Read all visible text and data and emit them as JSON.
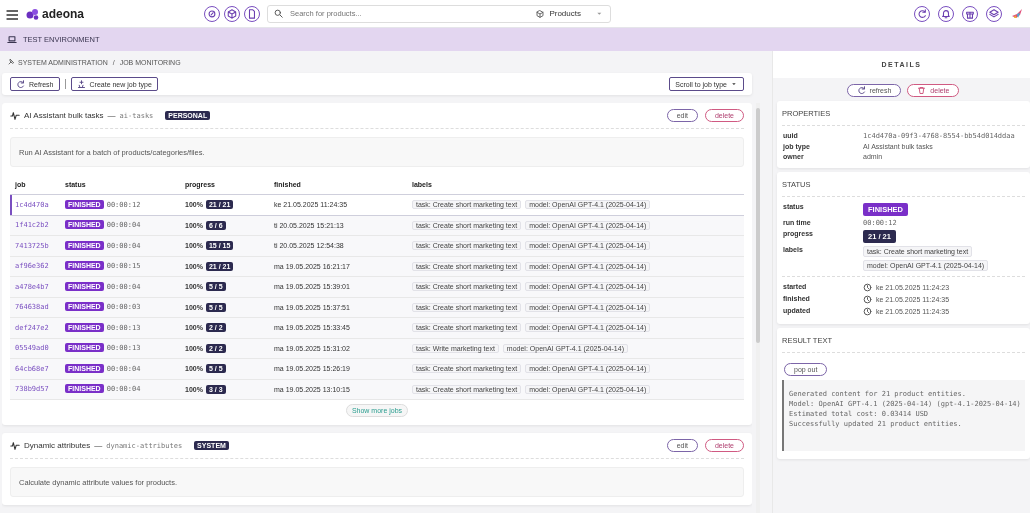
{
  "topbar": {
    "logo": "adeona",
    "search": {
      "placeholder": "Search for products..."
    },
    "scope": "Products"
  },
  "environment": "TEST ENVIRONMENT",
  "breadcrumb": {
    "items": [
      "SYSTEM ADMINISTRATION",
      "JOB MONITORING"
    ],
    "separator": "/"
  },
  "toolbar": {
    "refresh": "Refresh",
    "create": "Create new job type",
    "scroll": "Scroll to job type"
  },
  "job_types": [
    {
      "title": "AI Assistant bulk tasks",
      "dash": "—",
      "code": "ai-tasks",
      "badge": "PERSONAL",
      "edit": "edit",
      "delete": "delete",
      "description": "Run AI Assistant for a batch of products/categories/files.",
      "columns": [
        "job",
        "status",
        "progress",
        "finished",
        "labels"
      ],
      "rows": [
        {
          "job": "1c4d470a",
          "status": "FINISHED",
          "runtime": "00:00:12",
          "percent": "100%",
          "progress": "21 / 21",
          "finished": "ke 21.05.2025 11:24:35",
          "labels": [
            "task: Create short marketing text",
            "model: OpenAI GPT-4.1 (2025-04-14)"
          ],
          "selected": true
        },
        {
          "job": "1f41c2b2",
          "status": "FINISHED",
          "runtime": "00:00:04",
          "percent": "100%",
          "progress": "6 / 6",
          "finished": "ti 20.05.2025 15:21:13",
          "labels": [
            "task: Create short marketing text",
            "model: OpenAI GPT-4.1 (2025-04-14)"
          ],
          "selected": false
        },
        {
          "job": "7413725b",
          "status": "FINISHED",
          "runtime": "00:00:04",
          "percent": "100%",
          "progress": "15 / 15",
          "finished": "ti 20.05.2025 12:54:38",
          "labels": [
            "task: Create short marketing text",
            "model: OpenAI GPT-4.1 (2025-04-14)"
          ],
          "selected": false
        },
        {
          "job": "af96e362",
          "status": "FINISHED",
          "runtime": "00:00:15",
          "percent": "100%",
          "progress": "21 / 21",
          "finished": "ma 19.05.2025 16:21:17",
          "labels": [
            "task: Create short marketing text",
            "model: OpenAI GPT-4.1 (2025-04-14)"
          ],
          "selected": false
        },
        {
          "job": "a478e4b7",
          "status": "FINISHED",
          "runtime": "00:00:04",
          "percent": "100%",
          "progress": "5 / 5",
          "finished": "ma 19.05.2025 15:39:01",
          "labels": [
            "task: Create short marketing text",
            "model: OpenAI GPT-4.1 (2025-04-14)"
          ],
          "selected": false
        },
        {
          "job": "764638ad",
          "status": "FINISHED",
          "runtime": "00:00:03",
          "percent": "100%",
          "progress": "5 / 5",
          "finished": "ma 19.05.2025 15:37:51",
          "labels": [
            "task: Create short marketing text",
            "model: OpenAI GPT-4.1 (2025-04-14)"
          ],
          "selected": false
        },
        {
          "job": "def247e2",
          "status": "FINISHED",
          "runtime": "00:00:13",
          "percent": "100%",
          "progress": "2 / 2",
          "finished": "ma 19.05.2025 15:33:45",
          "labels": [
            "task: Create short marketing text",
            "model: OpenAI GPT-4.1 (2025-04-14)"
          ],
          "selected": false
        },
        {
          "job": "05549ad0",
          "status": "FINISHED",
          "runtime": "00:00:13",
          "percent": "100%",
          "progress": "2 / 2",
          "finished": "ma 19.05.2025 15:31:02",
          "labels": [
            "task: Write marketing text",
            "model: OpenAI GPT-4.1 (2025-04-14)"
          ],
          "selected": false
        },
        {
          "job": "64cb68e7",
          "status": "FINISHED",
          "runtime": "00:00:04",
          "percent": "100%",
          "progress": "5 / 5",
          "finished": "ma 19.05.2025 15:26:19",
          "labels": [
            "task: Create short marketing text",
            "model: OpenAI GPT-4.1 (2025-04-14)"
          ],
          "selected": false
        },
        {
          "job": "738b9d57",
          "status": "FINISHED",
          "runtime": "00:00:04",
          "percent": "100%",
          "progress": "3 / 3",
          "finished": "ma 19.05.2025 13:10:15",
          "labels": [
            "task: Create short marketing text",
            "model: OpenAI GPT-4.1 (2025-04-14)"
          ],
          "selected": false
        }
      ],
      "show_more": "Show more jobs"
    },
    {
      "title": "Dynamic attributes",
      "dash": "—",
      "code": "dynamic-attributes",
      "badge": "SYSTEM",
      "edit": "edit",
      "delete": "delete",
      "description": "Calculate dynamic attribute values for products."
    }
  ],
  "details": {
    "title": "DETAILS",
    "refresh": "refresh",
    "delete": "delete",
    "properties": {
      "title": "PROPERTIES",
      "items": [
        {
          "label": "uuid",
          "value": "1c4d470a-09f3-4768-8554-bb54d014ddaa",
          "kind": "mono"
        },
        {
          "label": "job type",
          "value": "AI Assistant bulk tasks",
          "kind": "text"
        },
        {
          "label": "owner",
          "value": "admin",
          "kind": "text"
        }
      ]
    },
    "status": {
      "title": "STATUS",
      "items": [
        {
          "label": "status",
          "value": "FINISHED",
          "kind": "status"
        },
        {
          "label": "run time",
          "value": "00:00:12",
          "kind": "mono"
        },
        {
          "label": "progress",
          "value": "21 / 21",
          "kind": "progress"
        }
      ],
      "labels": {
        "label": "labels",
        "values": [
          "task: Create short marketing text",
          "model: OpenAI GPT-4.1 (2025-04-14)"
        ]
      },
      "times": [
        {
          "label": "started",
          "value": "ke 21.05.2025 11:24:23"
        },
        {
          "label": "finished",
          "value": "ke 21.05.2025 11:24:35"
        },
        {
          "label": "updated",
          "value": "ke 21.05.2025 11:24:35"
        }
      ]
    },
    "result": {
      "title": "RESULT TEXT",
      "popout": "pop out",
      "lines": [
        "Generated content for 21 product entities.",
        "Model: OpenAI GPT-4.1 (2025-04-14) (gpt-4.1-2025-04-14)",
        "Estimated total cost: 0.03414 USD",
        "Successfully updated 21 product entities."
      ]
    }
  }
}
